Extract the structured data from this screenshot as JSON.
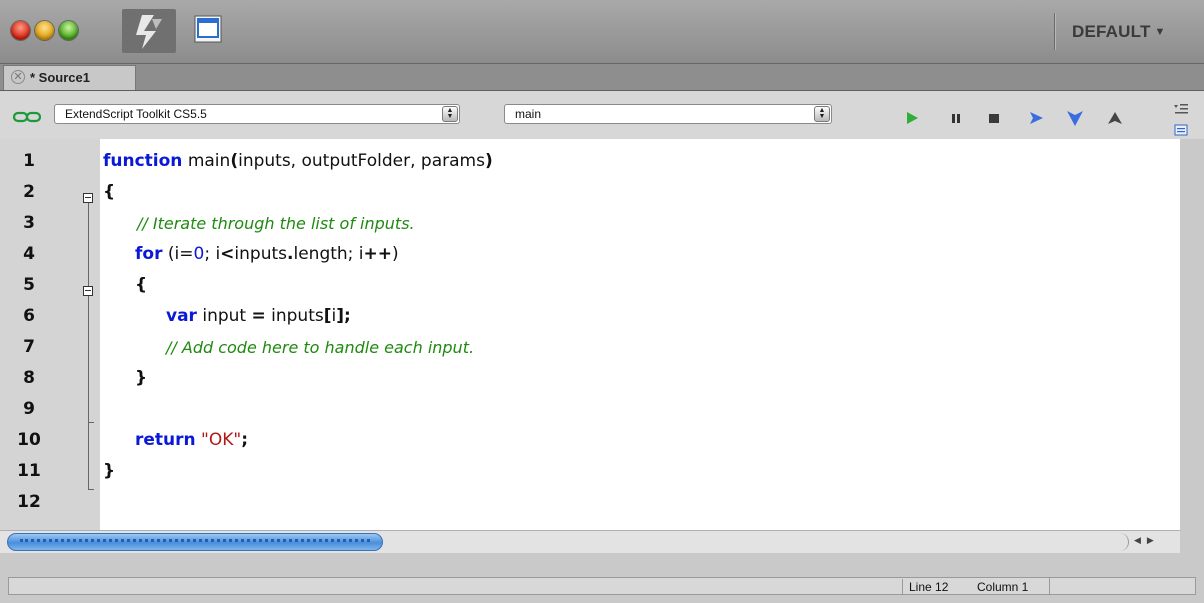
{
  "titlebar": {
    "workspace_label": "DEFAULT",
    "workspace_arrow": "▼"
  },
  "tabs": [
    {
      "label": "* Source1",
      "close_glyph": "✕"
    }
  ],
  "toolbar": {
    "target_select": "ExtendScript Toolkit CS5.5",
    "function_select": "main",
    "stepper_glyph": "▲▼",
    "icons": [
      "link-icon",
      "run-icon",
      "pause-icon",
      "stop-icon",
      "step-over-icon",
      "step-into-icon",
      "step-out-icon"
    ]
  },
  "editor": {
    "line_numbers": [
      "1",
      "2",
      "3",
      "4",
      "5",
      "6",
      "7",
      "8",
      "9",
      "10",
      "11",
      "12"
    ],
    "code": {
      "l1_kw": "function",
      "l1_rest": " main",
      "l1_paren_open": "(",
      "l1_args": "inputs, outputFolder, params",
      "l1_paren_close": ")",
      "l2": "{",
      "l3": "// Iterate through the list of inputs.",
      "l4_kw": "for",
      "l4_a": " (i=",
      "l4_num": "0",
      "l4_b": "; i",
      "l4_lt": "<",
      "l4_c": "inputs",
      "l4_dot": ".",
      "l4_d": "length; i",
      "l4_pp": "++",
      "l4_e": ")",
      "l5": "{",
      "l6_kw": "var",
      "l6_a": " input ",
      "l6_eq": "=",
      "l6_b": " inputs",
      "l6_bo": "[",
      "l6_c": "i",
      "l6_bc": "];",
      "l7": "// Add code here to handle each input.",
      "l8": "}",
      "l10_kw": "return",
      "l10_str": " \"OK\"",
      "l10_semi": ";",
      "l11": "}"
    }
  },
  "statusbar": {
    "line": "Line 12",
    "column": "Column 1"
  }
}
